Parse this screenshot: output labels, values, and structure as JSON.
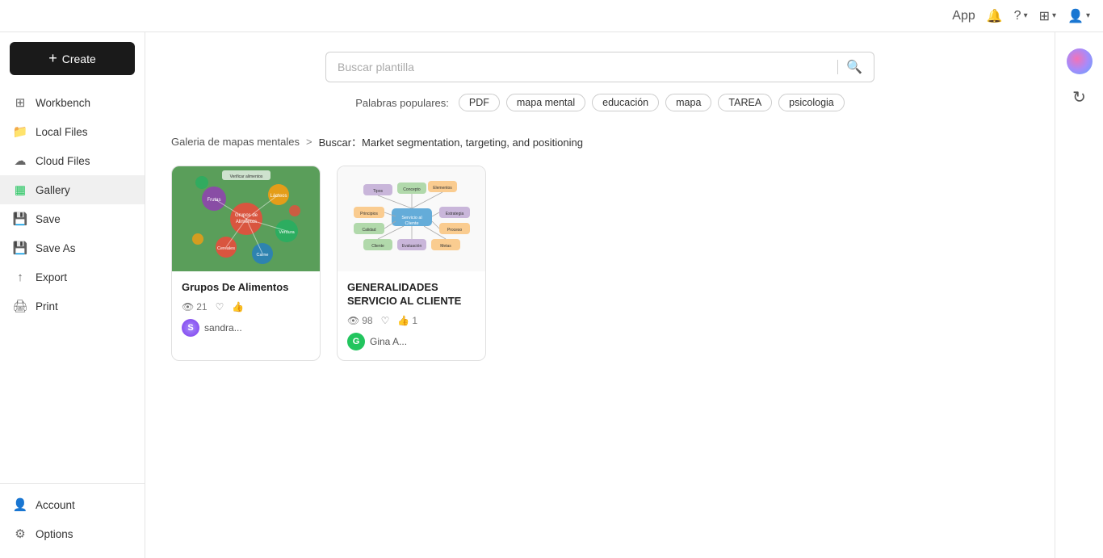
{
  "topbar": {
    "app_label": "App",
    "icons": [
      "bell-icon",
      "question-icon",
      "grid-icon",
      "user-icon"
    ]
  },
  "sidebar": {
    "create_label": "Create",
    "items": [
      {
        "id": "workbench",
        "label": "Workbench",
        "icon": "grid-icon"
      },
      {
        "id": "local-files",
        "label": "Local Files",
        "icon": "folder-icon"
      },
      {
        "id": "cloud-files",
        "label": "Cloud Files",
        "icon": "cloud-icon"
      },
      {
        "id": "gallery",
        "label": "Gallery",
        "icon": "gallery-icon",
        "active": true
      },
      {
        "id": "save",
        "label": "Save",
        "icon": "save-icon"
      },
      {
        "id": "save-as",
        "label": "Save As",
        "icon": "save-as-icon"
      },
      {
        "id": "export",
        "label": "Export",
        "icon": "export-icon"
      },
      {
        "id": "print",
        "label": "Print",
        "icon": "print-icon"
      }
    ],
    "bottom_items": [
      {
        "id": "account",
        "label": "Account",
        "icon": "account-icon"
      },
      {
        "id": "options",
        "label": "Options",
        "icon": "options-icon"
      }
    ]
  },
  "search": {
    "placeholder": "Buscar plantilla",
    "popular_label": "Palabras populares:",
    "tags": [
      "PDF",
      "mapa mental",
      "educación",
      "mapa",
      "TAREA",
      "psicologia"
    ]
  },
  "breadcrumb": {
    "home": "Galeria de mapas mentales",
    "separator": ">",
    "current": "Buscar：Market segmentation, targeting, and positioning"
  },
  "cards": [
    {
      "id": "card-1",
      "title": "Grupos De Alimentos",
      "views": "21",
      "likes": "",
      "thumbs": "",
      "author": "sandra...",
      "avatar_letter": "S",
      "avatar_color": "purple"
    },
    {
      "id": "card-2",
      "title": "GENERALIDADES SERVICIO AL CLIENTE",
      "views": "98",
      "likes": "",
      "thumbs": "1",
      "author": "Gina A...",
      "avatar_letter": "G",
      "avatar_color": "green"
    }
  ]
}
